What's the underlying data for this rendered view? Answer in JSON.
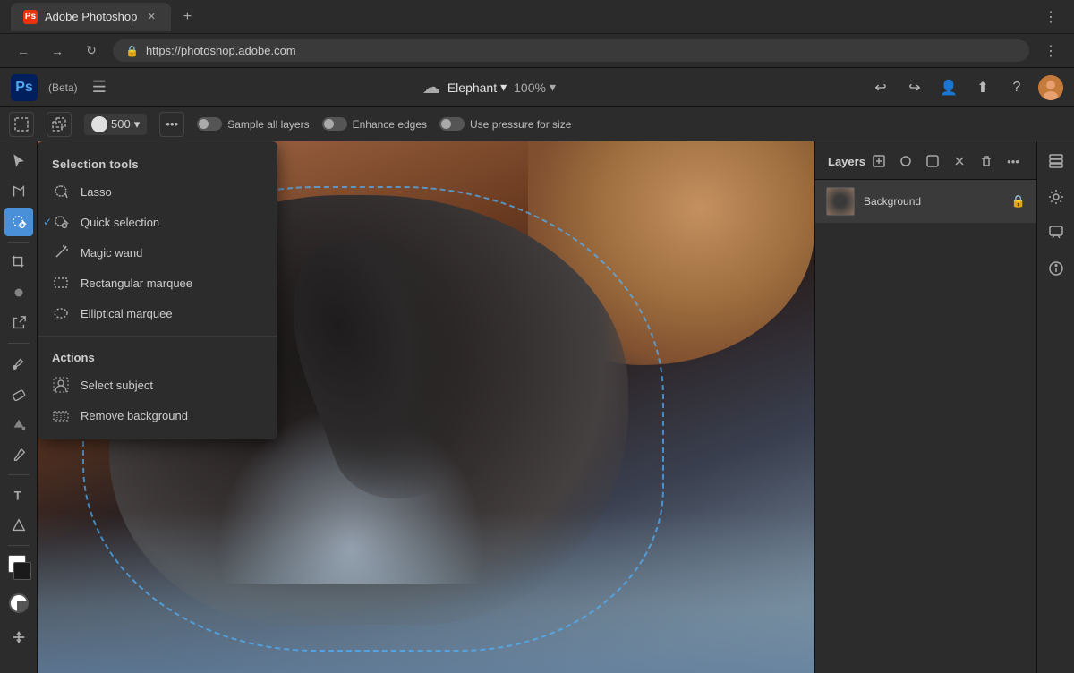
{
  "browser": {
    "tab_title": "Adobe Photoshop",
    "tab_icon": "Ps",
    "url": "https://photoshop.adobe.com",
    "nav_back": "←",
    "nav_forward": "→",
    "nav_refresh": "↻",
    "menu": "⋮",
    "new_tab": "+"
  },
  "appbar": {
    "logo": "Ps",
    "beta": "(Beta)",
    "doc_name": "Elephant",
    "zoom": "100%",
    "undo_icon": "↩",
    "redo_icon": "↪"
  },
  "options": {
    "brush_size": "500",
    "more": "•••",
    "sample_all_layers": "Sample all layers",
    "enhance_edges": "Enhance edges",
    "use_pressure": "Use pressure for size"
  },
  "toolbar": {
    "tools": [
      "select",
      "lasso",
      "quick-selection",
      "crop",
      "text",
      "shapes",
      "pen",
      "eyedropper",
      "eraser",
      "paint",
      "heal",
      "clone",
      "hand",
      "zoom"
    ]
  },
  "dropdown": {
    "section_title": "Selection tools",
    "items": [
      {
        "id": "lasso",
        "label": "Lasso",
        "selected": false,
        "icon": "lasso"
      },
      {
        "id": "quick-selection",
        "label": "Quick selection",
        "selected": true,
        "icon": "quick-sel"
      },
      {
        "id": "magic-wand",
        "label": "Magic wand",
        "selected": false,
        "icon": "wand"
      },
      {
        "id": "rect-marquee",
        "label": "Rectangular marquee",
        "selected": false,
        "icon": "rect"
      },
      {
        "id": "ellip-marquee",
        "label": "Elliptical marquee",
        "selected": false,
        "icon": "ellip"
      }
    ],
    "actions_title": "Actions",
    "actions": [
      {
        "id": "select-subject",
        "label": "Select subject",
        "icon": "subject"
      },
      {
        "id": "remove-bg",
        "label": "Remove background",
        "icon": "remove-bg"
      }
    ]
  },
  "layers": {
    "title": "Layers",
    "add_icon": "+",
    "layer_items": [
      {
        "id": "background",
        "name": "Background",
        "locked": true
      }
    ]
  },
  "colors": {
    "accent": "#4a90d9",
    "active_tool": "#4a90d9",
    "bg": "#2c2c2c",
    "dropdown_bg": "#2c2c2c",
    "panel_bg": "#2c2c2c"
  }
}
